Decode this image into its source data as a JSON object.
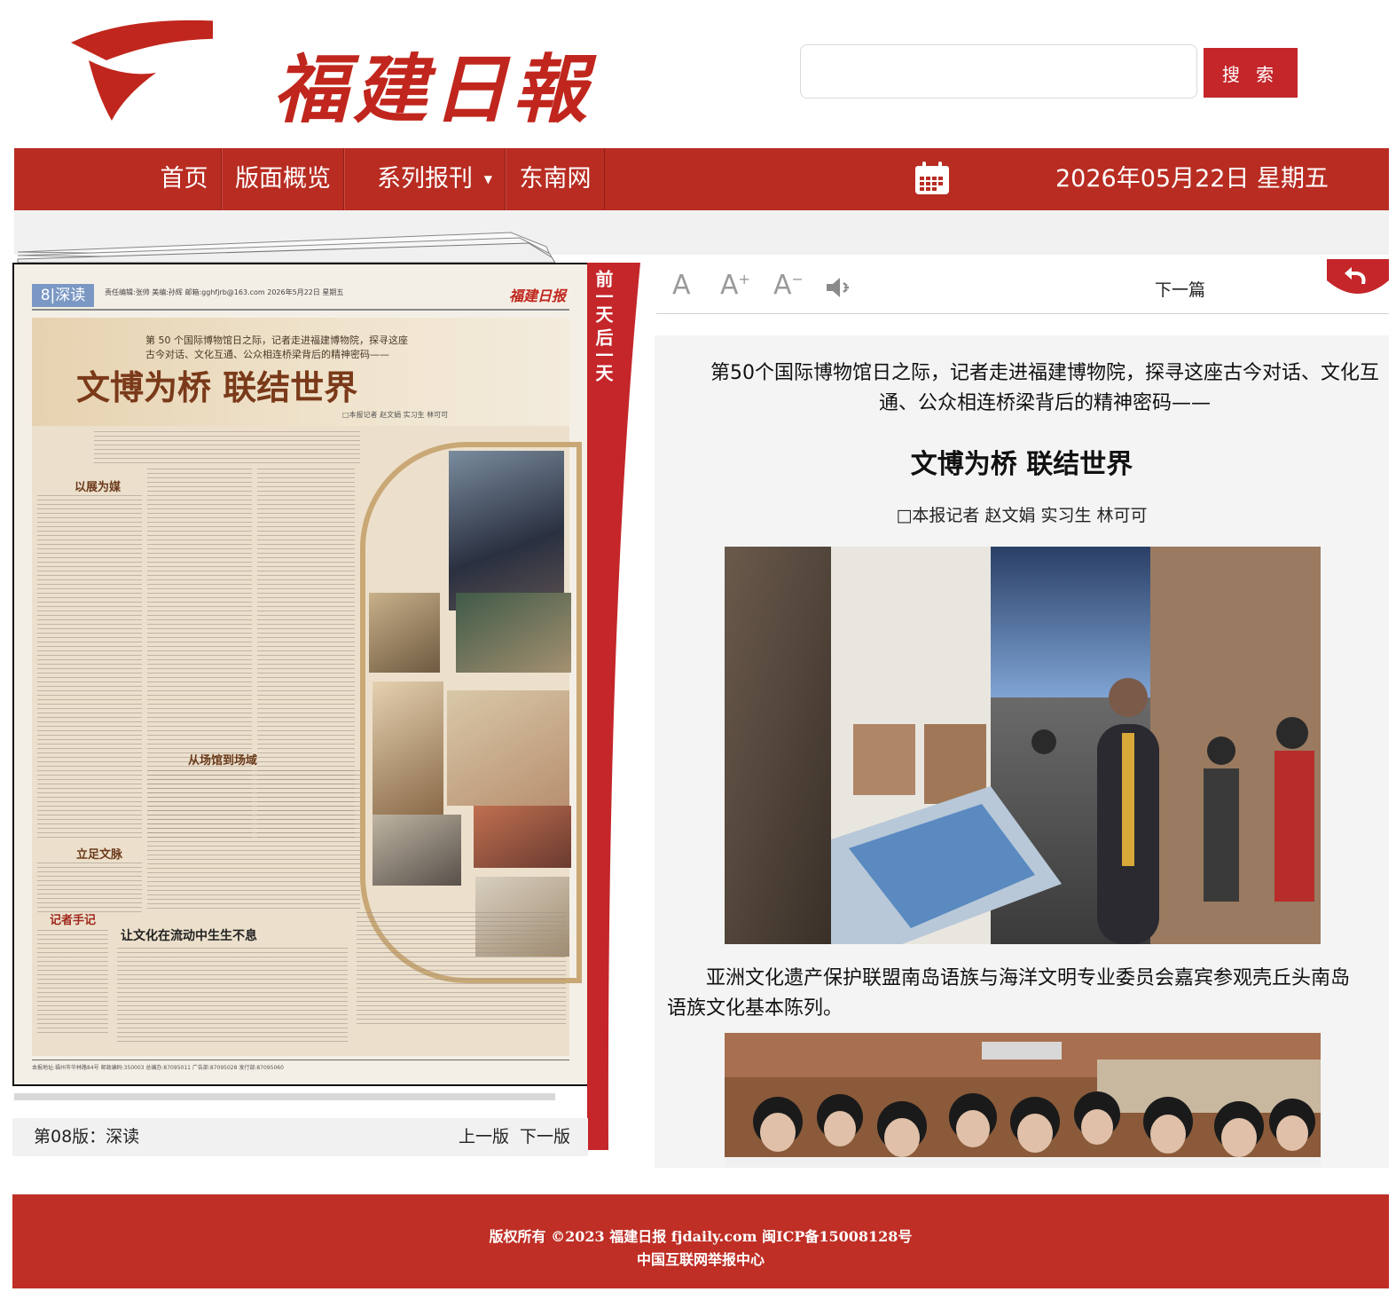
{
  "header": {
    "logo_text": "福建日報",
    "search": {
      "value": "",
      "placeholder": ""
    },
    "search_button": "搜 索"
  },
  "nav": {
    "items": [
      "首页",
      "版面概览",
      "系列报刊",
      "东南网"
    ],
    "date": "2026年05月22日  星期五"
  },
  "ribbon": {
    "prev_day": "前一天",
    "next_day": "后一天"
  },
  "newspaper": {
    "page_number": "8|深读",
    "meta": "责任编辑:张帅  美编:孙辉  邮箱:gghfjrb@163.com   2026年5月22日 星期五",
    "logo": "福建日报",
    "kicker_line1": "第 50 个国际博物馆日之际，记者走进福建博物院，探寻这座",
    "kicker_line2": "古今对话、文化互通、公众相连桥梁背后的精神密码——",
    "title": "文博为桥  联结世界",
    "byline": "□本报记者 赵文娟 实习生 林可可",
    "subhead1": "以展为媒",
    "subhead2": "从场馆到场域",
    "subhead3": "立足文脉",
    "notes_title": "记者手记",
    "essay_title": "让文化在流动中生生不息"
  },
  "page_info": {
    "label": "第08版：深读",
    "prev": "上一版",
    "next": "下一版"
  },
  "toolbar": {
    "font_default": "A",
    "font_increase": "A",
    "font_increase_mark": "+",
    "font_decrease": "A",
    "font_decrease_mark": "−",
    "next_article": "下一篇"
  },
  "article": {
    "kicker": "第50个国际博物馆日之际，记者走进福建博物院，探寻这座古今对话、文化互通、公众相连桥梁背后的精神密码——",
    "headline": "文博为桥 联结世界",
    "byline": "□本报记者 赵文娟 实习生 林可可",
    "caption": "亚洲文化遗产保护联盟南岛语族与海洋文明专业委员会嘉宾参观壳丘头南岛语族文化基本陈列。"
  },
  "footer": {
    "copyright": "版权所有 ©2023 福建日报 fjdaily.com 闽ICP备15008128号",
    "report": "中国互联网举报中心"
  },
  "colors": {
    "brand_red": "#b82c22",
    "button_red": "#c4262a",
    "footer_red": "#bf2f26"
  }
}
